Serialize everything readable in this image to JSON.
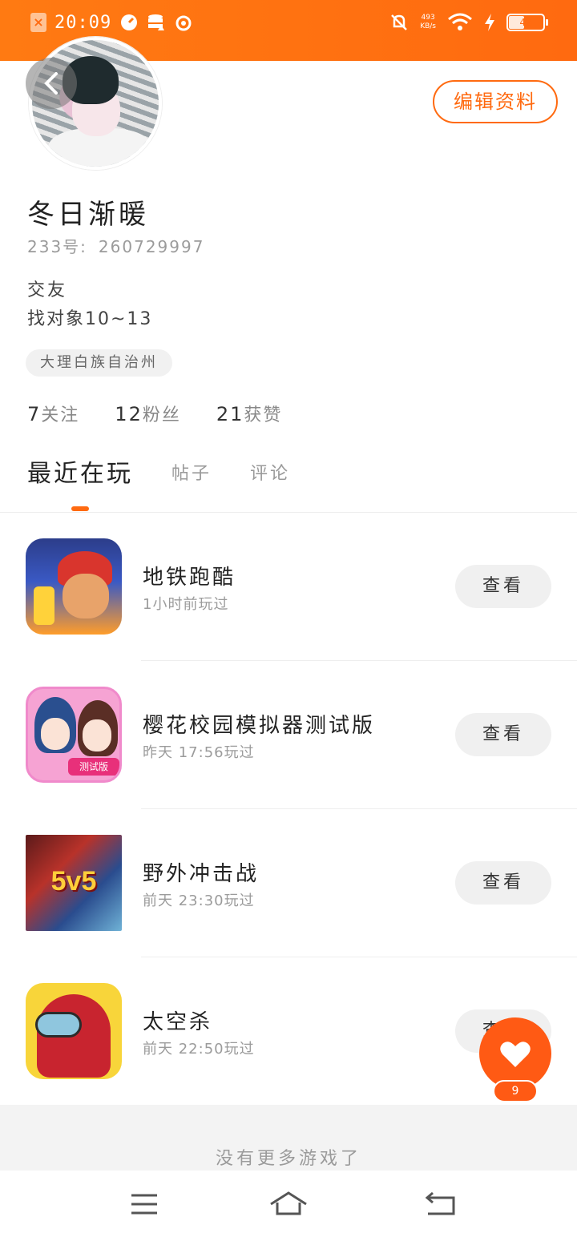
{
  "status_bar": {
    "time": "20:09",
    "net_speed_value": "493",
    "net_speed_unit": "KB/s",
    "battery": "42",
    "icons": [
      "close-box-icon",
      "speedometer-icon",
      "database-icon",
      "weibo-icon",
      "mute-bell-icon",
      "wifi-icon",
      "charging-bolt-icon",
      "battery-icon"
    ]
  },
  "profile": {
    "edit_label": "编辑资料",
    "nickname": "冬日渐暖",
    "id_label": "233号:",
    "id_value": "260729997",
    "bio_line1": "交友",
    "bio_line2": "找对象10~13",
    "location": "大理白族自治州"
  },
  "stats": [
    {
      "value": "7",
      "label": "关注"
    },
    {
      "value": "12",
      "label": "粉丝"
    },
    {
      "value": "21",
      "label": "获赞"
    }
  ],
  "tabs": [
    {
      "label": "最近在玩",
      "active": true
    },
    {
      "label": "帖子",
      "active": false
    },
    {
      "label": "评论",
      "active": false
    }
  ],
  "games": [
    {
      "name": "地铁跑酷",
      "played": "1小时前玩过",
      "action": "查看",
      "icon": "subway-surfers-icon"
    },
    {
      "name": "樱花校园模拟器测试版",
      "played": "昨天 17:56玩过",
      "action": "查看",
      "icon": "sakura-school-icon",
      "badge": "测试版"
    },
    {
      "name": "野外冲击战",
      "played": "前天 23:30玩过",
      "action": "查看",
      "icon": "wild-clash-icon",
      "badge": "5v5"
    },
    {
      "name": "太空杀",
      "played": "前天 22:50玩过",
      "action": "查看",
      "icon": "space-kill-icon"
    }
  ],
  "footer_text": "没有更多游戏了",
  "fab": {
    "count": "9",
    "icon": "heart-icon"
  },
  "nav": {
    "icons": [
      "menu-icon",
      "home-icon",
      "back-icon"
    ]
  },
  "colors": {
    "accent": "#ff6a10",
    "status_bar": "#ff7a12"
  }
}
